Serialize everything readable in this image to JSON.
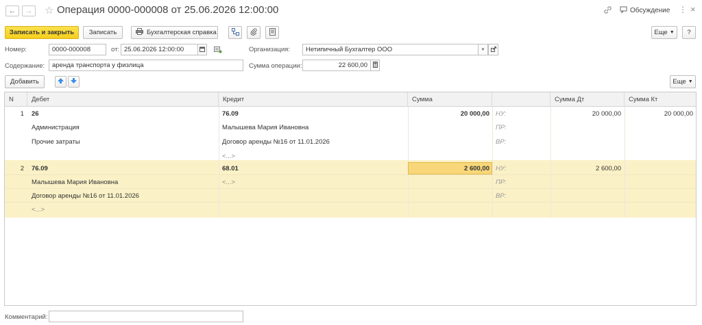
{
  "header": {
    "title": "Операция 0000-000008 от 25.06.2026 12:00:00",
    "discuss_label": "Обсуждение"
  },
  "toolbar": {
    "save_close_label": "Записать и закрыть",
    "save_label": "Записать",
    "report_label": "Бухгалтерская справка",
    "more_label": "Еще",
    "help_label": "?"
  },
  "form": {
    "number_label": "Номер:",
    "number_value": "0000-000008",
    "date_label": "от:",
    "date_value": "25.06.2026 12:00:00",
    "org_label": "Организация:",
    "org_value": "Нетипичный Бухгалтер ООО",
    "content_label": "Содержание:",
    "content_value": "аренда транспорта у физлица",
    "sum_label": "Сумма операции:",
    "sum_value": "22 600,00"
  },
  "table_toolbar": {
    "add_label": "Добавить",
    "more_label": "Еще"
  },
  "table": {
    "columns": [
      "N",
      "Дебет",
      "Кредит",
      "Сумма",
      "",
      "Сумма Дт",
      "Сумма Кт"
    ],
    "rows": [
      {
        "n": "1",
        "debit": [
          "26",
          "Администрация",
          "Прочие затраты",
          ""
        ],
        "credit": [
          "76.09",
          "Малышева Мария Ивановна",
          "Договор аренды №16 от 11.01.2026",
          "<...>"
        ],
        "sum": "20 000,00",
        "tags": [
          "НУ:",
          "ПР:",
          "ВР:"
        ],
        "sum_dt": "20 000,00",
        "sum_kt": "20 000,00"
      },
      {
        "n": "2",
        "debit": [
          "76.09",
          "Малышева Мария Ивановна",
          "Договор аренды №16 от 11.01.2026",
          "<...>"
        ],
        "credit": [
          "68.01",
          "<...>",
          "",
          ""
        ],
        "sum": "2 600,00",
        "tags": [
          "НУ:",
          "ПР:",
          "ВР:"
        ],
        "sum_dt": "2 600,00",
        "sum_kt": ""
      }
    ]
  },
  "footer": {
    "comment_label": "Комментарий:",
    "comment_value": ""
  },
  "colors": {
    "primary_button": "#f5cf1c",
    "selected_row": "#fbf1c7",
    "active_cell": "#f7d77a",
    "arrow_blue": "#3a8ee6"
  }
}
